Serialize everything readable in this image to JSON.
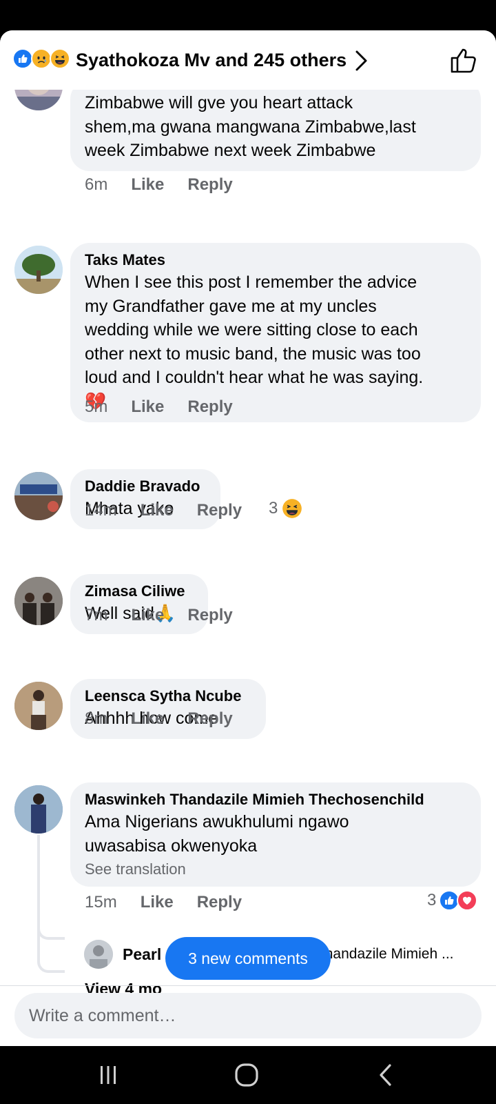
{
  "header": {
    "title": "Syathokoza Mv and 245 others",
    "reaction_icons": [
      "like-icon",
      "sad-icon",
      "haha-icon"
    ]
  },
  "comments": [
    {
      "name": "",
      "text_lines": [
        "Zimbabwe will gve you heart attack",
        "shem,ma gwana mangwana Zimbabwe,last",
        "week Zimbabwe next week Zimbabwe"
      ],
      "time": "6m",
      "like": "Like",
      "reply": "Reply"
    },
    {
      "name": "Taks Mates",
      "text_lines": [
        "When I see this post I remember the advice",
        "my Grandfather gave me at my uncles",
        "wedding while we were sitting close to each",
        "other next to music band, the music was too",
        "loud and I couldn't hear what he was saying."
      ],
      "emoji": "💔",
      "time": "5m",
      "like": "Like",
      "reply": "Reply"
    },
    {
      "name": "Daddie Bravado",
      "text_lines": [
        "Mhata yako"
      ],
      "time": "14m",
      "like": "Like",
      "reply": "Reply",
      "reaction_count": "3",
      "reaction_icons": [
        "haha-icon"
      ]
    },
    {
      "name": "Zimasa Ciliwe",
      "text_lines": [
        "Well said"
      ],
      "emoji": "🙏",
      "time": "7m",
      "like": "Like",
      "reply": "Reply"
    },
    {
      "name": "Leensca Sytha Ncube",
      "text_lines": [
        "Ahhhh how come"
      ],
      "time": "8m",
      "like": "Like",
      "reply": "Reply"
    },
    {
      "name": "Maswinkeh Thandazile Mimieh Thechosenchild",
      "text_lines": [
        "Ama Nigerians awukhulumi ngawo",
        "uwasabisa okwenyoka"
      ],
      "see_translation": "See translation",
      "time": "15m",
      "like": "Like",
      "reply": "Reply",
      "reaction_count": "3",
      "reaction_icons": [
        "like-icon",
        "love-icon"
      ]
    }
  ],
  "reply_preview": {
    "name": "Pearl Seakgele",
    "text": "Maswinkeh Thandazile Mimieh ..."
  },
  "view_more": "View 4 mo",
  "new_comments_button": "3 new comments",
  "composer": {
    "placeholder": "Write a comment…"
  },
  "colors": {
    "accent": "#1877f2",
    "bubble": "#f0f2f5",
    "meta": "#65676b",
    "love": "#f33e58",
    "haha": "#f7b125"
  }
}
